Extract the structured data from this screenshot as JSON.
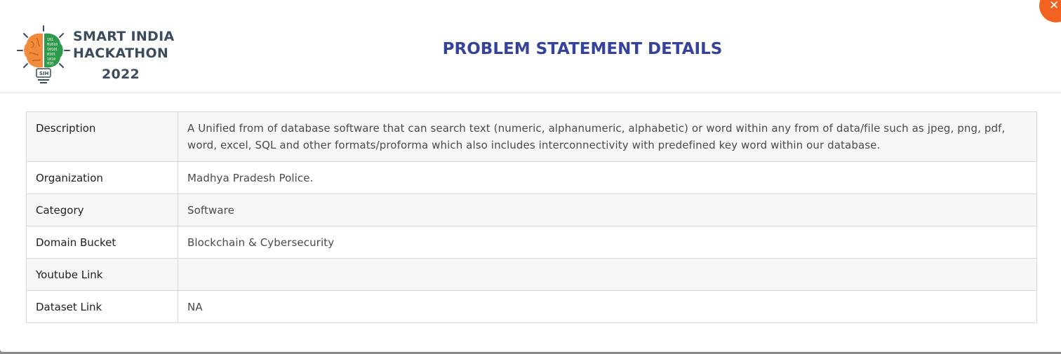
{
  "logo": {
    "line1": "SMART INDIA",
    "line2": "HACKATHON",
    "year": "2022",
    "badge": "SIH"
  },
  "header": {
    "title": "PROBLEM STATEMENT DETAILS",
    "close_icon": "close-icon",
    "close_symbol": "✕"
  },
  "details": {
    "rows": [
      {
        "label": "Description",
        "value": "A Unified from of database software that can search text (numeric, alphanumeric, alphabetic) or word within any from of data/file such as jpeg, png, pdf, word, excel, SQL and other formats/proforma which also includes interconnectivity with predefined key word within our database."
      },
      {
        "label": "Organization",
        "value": "Madhya Pradesh Police."
      },
      {
        "label": "Category",
        "value": "Software"
      },
      {
        "label": "Domain Bucket",
        "value": "Blockchain & Cybersecurity"
      },
      {
        "label": "Youtube Link",
        "value": ""
      },
      {
        "label": "Dataset Link",
        "value": "NA"
      }
    ]
  },
  "colors": {
    "title": "#35449a",
    "close_button": "#f26322",
    "brain_left": "#f08a3c",
    "brain_right": "#2e9a4b"
  }
}
